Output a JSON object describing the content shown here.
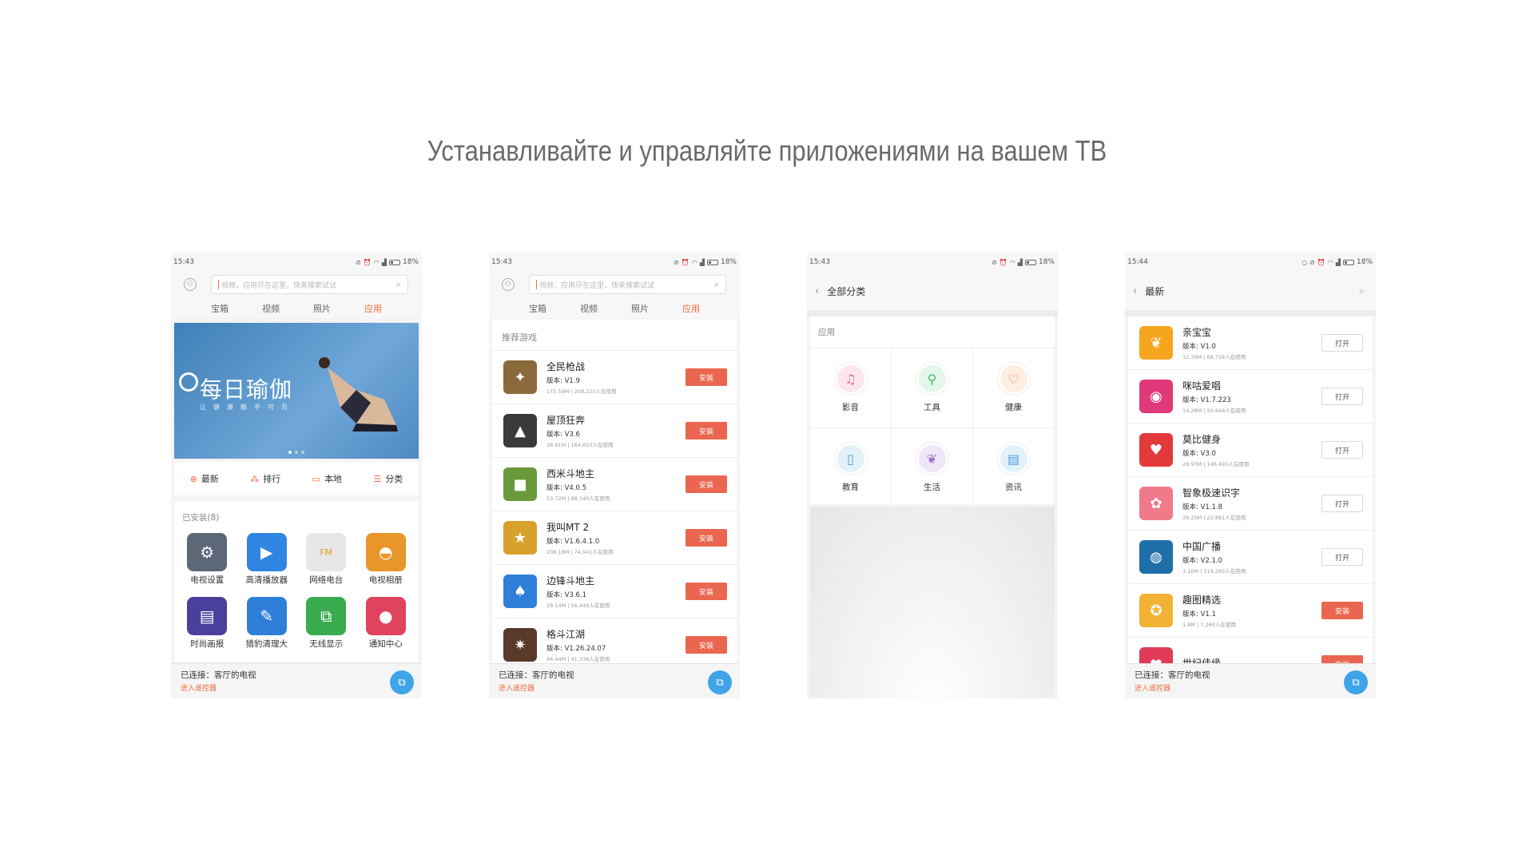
{
  "page": {
    "faded_title": "",
    "headline": "Устанавливайте и управляйте приложениями на вашем ТВ"
  },
  "colors": {
    "accent": "#f06a3c",
    "install_button": "#ea6650",
    "connect_button": "#3fa4e8"
  },
  "shared": {
    "search_placeholder": "视频，应用尽在这里，快来搜索试试",
    "tabs": [
      "宝箱",
      "视频",
      "照片",
      "应用"
    ],
    "active_tab": "应用",
    "connected": "已连接：客厅的电视",
    "enter_remote": "进入遥控器",
    "battery": "18%"
  },
  "screen1": {
    "time": "15:43",
    "banner": {
      "title": "每日瑜伽",
      "subtitle": "让健康触手可及"
    },
    "quick": [
      {
        "label": "最新",
        "icon": "new-icon"
      },
      {
        "label": "排行",
        "icon": "rank-icon"
      },
      {
        "label": "本地",
        "icon": "folder-icon"
      },
      {
        "label": "分类",
        "icon": "list-icon"
      }
    ],
    "installed_header": "已安装(8)",
    "apps": [
      {
        "label": "电视设置",
        "icon": "settings-gear-icon",
        "color": "#5c6778"
      },
      {
        "label": "高清播放器",
        "icon": "play-icon",
        "color": "#2f86e2"
      },
      {
        "label": "网络电台",
        "icon": "radio-icon",
        "color": "#e7e7e7"
      },
      {
        "label": "电视相册",
        "icon": "photo-album-icon",
        "color": "#e8962a"
      },
      {
        "label": "时尚画报",
        "icon": "magazine-icon",
        "color": "#4b3f9c"
      },
      {
        "label": "猎豹清理大",
        "icon": "broom-icon",
        "color": "#2f7fd8"
      },
      {
        "label": "无线显示",
        "icon": "screen-mirror-icon",
        "color": "#3aaa4f"
      },
      {
        "label": "通知中心",
        "icon": "chat-bubble-icon",
        "color": "#e0435d"
      }
    ]
  },
  "screen2": {
    "time": "15:43",
    "section": "推荐游戏",
    "games": [
      {
        "name": "全民枪战",
        "version": "版本: V1.9",
        "stats": "175.59M | 208,223人在使用",
        "action": "安装",
        "color": "#8a6a3a"
      },
      {
        "name": "屋顶狂奔",
        "version": "版本: V3.6",
        "stats": "18.91M | 164,603人在使用",
        "action": "安装",
        "color": "#3a3a3a"
      },
      {
        "name": "西米斗地主",
        "version": "版本: V4.0.5",
        "stats": "53.72M | 88,340人在使用",
        "action": "安装",
        "color": "#6b9a3c"
      },
      {
        "name": "我叫MT 2",
        "version": "版本: V1.6.4.1.0",
        "stats": "208.18M | 74,941人在使用",
        "action": "安装",
        "color": "#d8a12a"
      },
      {
        "name": "边锋斗地主",
        "version": "版本: V3.6.1",
        "stats": "28.14M | 56,449人在使用",
        "action": "安装",
        "color": "#2f7fd8"
      },
      {
        "name": "格斗江湖",
        "version": "版本: V1.26.24.07",
        "stats": "84.44M | 41,338人在使用",
        "action": "安装",
        "color": "#5a3a2a"
      }
    ]
  },
  "screen3": {
    "time": "15:43",
    "title": "全部分类",
    "section": "应用",
    "categories": [
      {
        "label": "影音",
        "icon": "media-icon",
        "color": "#fde7ec",
        "fg": "#e66a86"
      },
      {
        "label": "工具",
        "icon": "tool-icon",
        "color": "#e4f6ea",
        "fg": "#4bb46a"
      },
      {
        "label": "健康",
        "icon": "stethoscope-icon",
        "color": "#fdeee2",
        "fg": "#e98f4e"
      },
      {
        "label": "教育",
        "icon": "book-icon",
        "color": "#e3f2f9",
        "fg": "#4aa1c8"
      },
      {
        "label": "生活",
        "icon": "leaf-icon",
        "color": "#efe7f7",
        "fg": "#9b78c9"
      },
      {
        "label": "资讯",
        "icon": "news-icon",
        "color": "#e3f1fb",
        "fg": "#4a9be0"
      }
    ]
  },
  "screen4": {
    "time": "15:44",
    "title": "最新",
    "apps": [
      {
        "name": "亲宝宝",
        "version": "版本: V1.0",
        "stats": "12.39M | 68,734人在使用",
        "action": "打开",
        "kind": "open",
        "color": "#f5a51e"
      },
      {
        "name": "咪咕爱唱",
        "version": "版本: V1.7.223",
        "stats": "14.28M | 50,648人在使用",
        "action": "打开",
        "kind": "open",
        "color": "#e0397a"
      },
      {
        "name": "莫比健身",
        "version": "版本: V3.0",
        "stats": "28.93M | 146,495人在使用",
        "action": "打开",
        "kind": "open",
        "color": "#e23a3a"
      },
      {
        "name": "智象极速识字",
        "version": "版本: V1.1.8",
        "stats": "39.25M | 22,881人在使用",
        "action": "打开",
        "kind": "open",
        "color": "#f07a8a"
      },
      {
        "name": "中国广播",
        "version": "版本: V2.1.0",
        "stats": "3.16M | 119,285人在使用",
        "action": "打开",
        "kind": "open",
        "color": "#1e6fa8"
      },
      {
        "name": "趣图精选",
        "version": "版本: V1.1",
        "stats": "1.8M | 7,260人在使用",
        "action": "安装",
        "kind": "install",
        "color": "#f2b233"
      },
      {
        "name": "世纪佳缘",
        "version": "",
        "stats": "",
        "action": "安装",
        "kind": "install",
        "color": "#e03a56"
      }
    ]
  }
}
